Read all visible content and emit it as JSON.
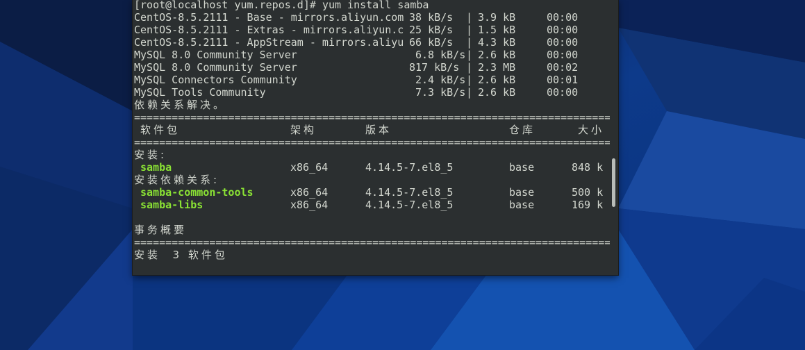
{
  "terminal": {
    "prompt_line": "[root@localhost yum.repos.d]# yum install samba",
    "repos": [
      {
        "name": "CentOS-8.5.2111 - Base - mirrors.aliyun.com",
        "speed": "38 kB/s",
        "size": "3.9 kB",
        "time": "00:00"
      },
      {
        "name": "CentOS-8.5.2111 - Extras - mirrors.aliyun.c",
        "speed": "25 kB/s",
        "size": "1.5 kB",
        "time": "00:00"
      },
      {
        "name": "CentOS-8.5.2111 - AppStream - mirrors.aliyu",
        "speed": "66 kB/s",
        "size": "4.3 kB",
        "time": "00:00"
      },
      {
        "name": "MySQL 8.0 Community Server",
        "speed": "6.8 kB/s",
        "size": "2.6 kB",
        "time": "00:00"
      },
      {
        "name": "MySQL 8.0 Community Server",
        "speed": "817 kB/s",
        "size": "2.3 MB",
        "time": "00:02"
      },
      {
        "name": "MySQL Connectors Community",
        "speed": "2.4 kB/s",
        "size": "2.6 kB",
        "time": "00:01"
      },
      {
        "name": "MySQL Tools Community",
        "speed": "7.3 kB/s",
        "size": "2.6 kB",
        "time": "00:00"
      }
    ],
    "pipe": "|",
    "deps_resolved": "依赖关系解决。",
    "separator": "=============================================================================",
    "headers": {
      "package": "软件包",
      "arch": "架构",
      "version": "版本",
      "repo": "仓库",
      "size": "大小"
    },
    "install_label": "安装:",
    "install_packages": [
      {
        "name": "samba",
        "arch": "x86_64",
        "version": "4.14.5-7.el8_5",
        "repo": "base",
        "size": "848 k"
      }
    ],
    "deps_label": "安装依赖关系:",
    "dep_packages": [
      {
        "name": "samba-common-tools",
        "arch": "x86_64",
        "version": "4.14.5-7.el8_5",
        "repo": "base",
        "size": "500 k"
      },
      {
        "name": "samba-libs",
        "arch": "x86_64",
        "version": "4.14.5-7.el8_5",
        "repo": "base",
        "size": "169 k"
      }
    ],
    "summary_label": "事务概要",
    "summary_line": "安装  3 软件包"
  },
  "colors": {
    "terminal_bg": "#2b2f30",
    "terminal_text": "#d3d7cf",
    "package_green": "#8ae234",
    "desktop_blue": "#0b2a66"
  }
}
